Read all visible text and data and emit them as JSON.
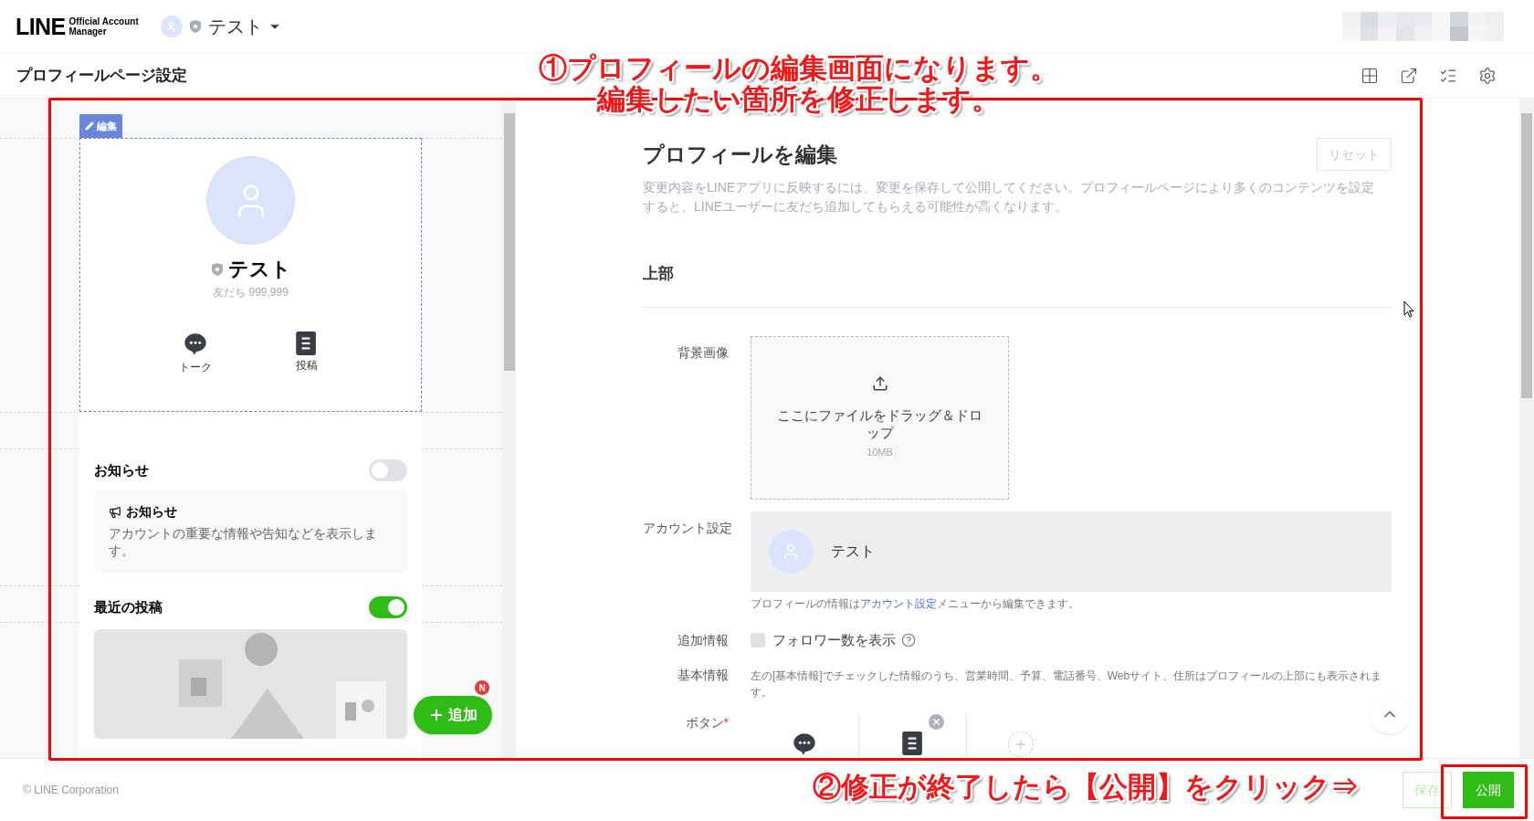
{
  "header": {
    "logo_main": "LINE",
    "logo_sub": [
      "Official Account",
      "Manager"
    ],
    "account_name": "テスト"
  },
  "page_title": "プロフィールページ設定",
  "preview": {
    "edit_tag": "編集",
    "name": "テスト",
    "friends": "友だち 999,999",
    "actions": [
      {
        "kind": "talk",
        "label": "トーク"
      },
      {
        "kind": "post",
        "label": "投稿"
      }
    ],
    "sections": [
      {
        "kind": "notice",
        "title": "お知らせ",
        "on": false,
        "card_title": "お知らせ",
        "card_text": "アカウントの重要な情報や告知などを表示します。"
      },
      {
        "kind": "posts",
        "title": "最近の投稿",
        "on": true
      }
    ],
    "add_button": {
      "label": "追加",
      "badge": "N"
    }
  },
  "editor": {
    "title": "プロフィールを編集",
    "reset": "リセット",
    "description": "変更内容をLINEアプリに反映するには、変更を保存して公開してください。プロフィールページにより多くのコンテンツを設定すると、LINEユーザーに友だち追加してもらえる可能性が高くなります。",
    "section": "上部",
    "background": {
      "label": "背景画像",
      "drop_text": "ここにファイルをドラッグ＆ドロップ",
      "size": "10MB"
    },
    "account": {
      "label": "アカウント設定",
      "name": "テスト",
      "note_before": "プロフィールの情報は",
      "note_link": "アカウント設定",
      "note_after": "メニューから編集できます。"
    },
    "extra": {
      "label": "追加情報",
      "checkbox": "フォロワー数を表示",
      "checked": false
    },
    "basic": {
      "label": "基本情報",
      "text": "左の[基本情報]でチェックした情報のうち、営業時間、予算、電話番号、Webサイト、住所はプロフィールの上部にも表示されます。"
    },
    "buttons": {
      "label": "ボタン",
      "required_mark": "*",
      "items": [
        {
          "kind": "talk",
          "removable": false
        },
        {
          "kind": "post",
          "removable": true
        },
        {
          "kind": "add",
          "removable": false
        }
      ]
    }
  },
  "footer": {
    "copyright": "© LINE Corporation",
    "save": "保存",
    "publish": "公開"
  },
  "annotations": [
    {
      "lines": [
        "①プロフィールの編集画面になります。",
        "編集したい箇所を修正します。"
      ]
    },
    {
      "lines": [
        "②修正が終了したら【公開】をクリック⇒"
      ]
    }
  ]
}
